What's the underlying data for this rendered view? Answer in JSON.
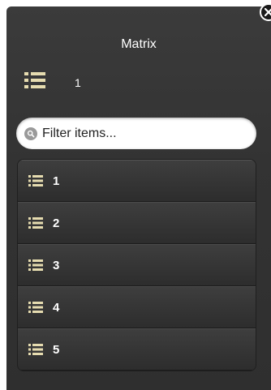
{
  "header": {
    "title": "Matrix",
    "count": "1",
    "accent_color": "#e6dcb0"
  },
  "filter": {
    "placeholder": "Filter items..."
  },
  "list": {
    "items": [
      {
        "label": "1"
      },
      {
        "label": "2"
      },
      {
        "label": "3"
      },
      {
        "label": "4"
      },
      {
        "label": "5"
      }
    ]
  }
}
